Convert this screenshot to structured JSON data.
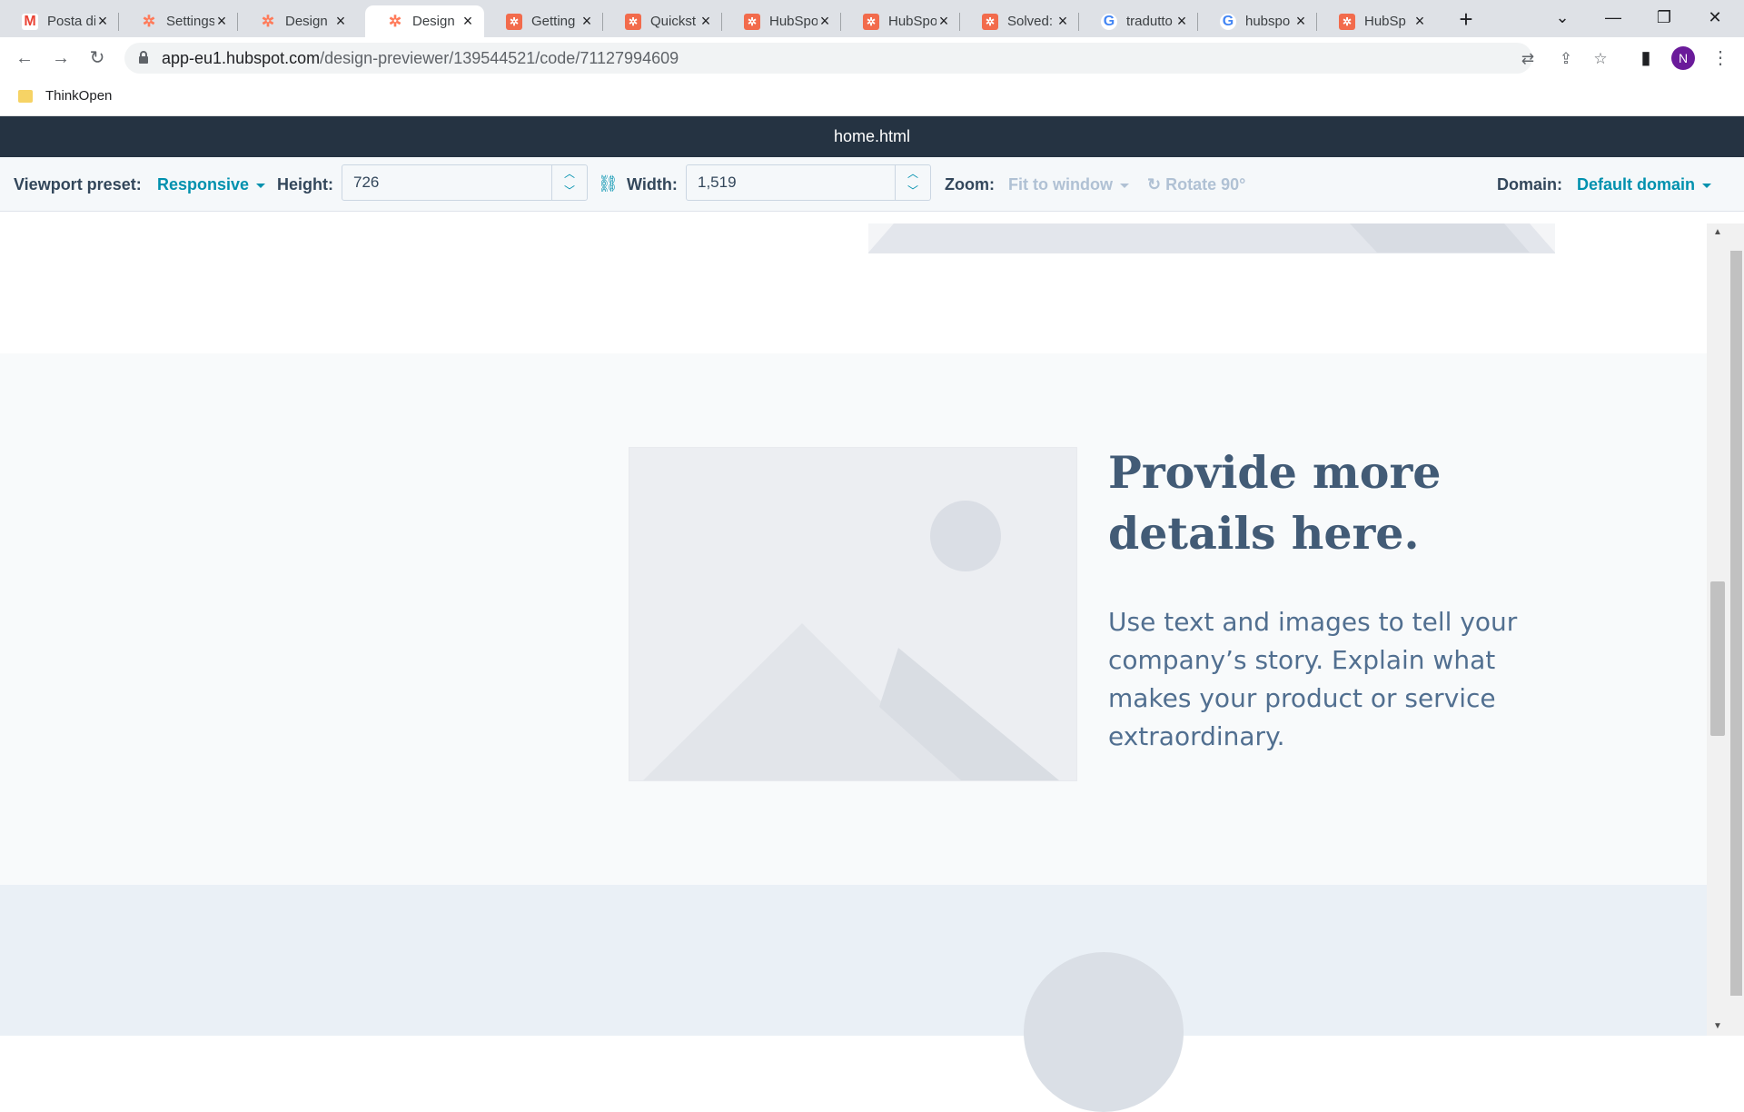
{
  "browser": {
    "tabs": [
      {
        "title": "Posta di",
        "favicon": "gmail-icon"
      },
      {
        "title": "Settings",
        "favicon": "hubspot-sprocket-icon"
      },
      {
        "title": "Design",
        "favicon": "hubspot-sprocket-icon"
      },
      {
        "title": "Design",
        "favicon": "hubspot-sprocket-icon",
        "active": true
      },
      {
        "title": "Getting",
        "favicon": "hubspot-square-icon"
      },
      {
        "title": "Quickst",
        "favicon": "hubspot-square-icon"
      },
      {
        "title": "HubSpo",
        "favicon": "hubspot-square-icon"
      },
      {
        "title": "HubSpo",
        "favicon": "hubspot-square-icon"
      },
      {
        "title": "Solved:",
        "favicon": "hubspot-square-icon"
      },
      {
        "title": "tradutto",
        "favicon": "google-icon"
      },
      {
        "title": "hubspo",
        "favicon": "google-icon"
      },
      {
        "title": "HubSp",
        "favicon": "hubspot-square-icon"
      }
    ],
    "url_host": "app-eu1.hubspot.com",
    "url_path": "/design-previewer/139544521/code/71127994609",
    "profile_initial": "N",
    "bookmark": "ThinkOpen"
  },
  "previewer": {
    "file_name": "home.html",
    "viewport_label": "Viewport preset:",
    "viewport_value": "Responsive",
    "height_label": "Height:",
    "height_value": "726",
    "width_label": "Width:",
    "width_value": "1,519",
    "zoom_label": "Zoom:",
    "zoom_value": "Fit to window",
    "rotate_label": "Rotate 90°",
    "domain_label": "Domain:",
    "domain_value": "Default domain"
  },
  "page": {
    "headline": "Provide more details here.",
    "body": "Use text and images to tell your company’s story. Explain what makes your product or service extraordinary."
  },
  "colors": {
    "header_bg": "#253342",
    "accent": "#0091ae",
    "headline": "#425b76"
  }
}
